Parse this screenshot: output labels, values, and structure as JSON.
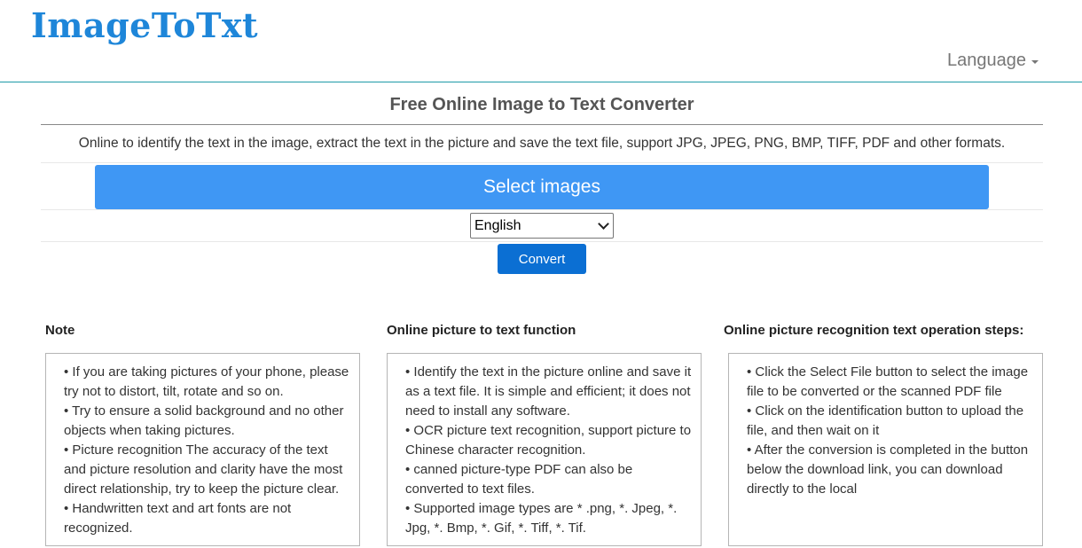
{
  "header": {
    "logo": "ImageToTxt",
    "language_menu": "Language"
  },
  "main": {
    "title": "Free Online Image to Text Converter",
    "description": "Online to identify the text in the image, extract the text in the picture and save the text file, support JPG, JPEG, PNG, BMP, TIFF, PDF and other formats.",
    "select_button": "Select images",
    "language_select": {
      "selected": "English"
    },
    "convert_button": "Convert"
  },
  "columns": [
    {
      "heading": "Note",
      "items": [
        "• If you are taking pictures of your phone, please try not to distort, tilt, rotate and so on.",
        "• Try to ensure a solid background and no other objects when taking pictures.",
        "• Picture recognition The accuracy of the text and picture resolution and clarity have the most direct relationship, try to keep the picture clear.",
        "• Handwritten text and art fonts are not recognized."
      ]
    },
    {
      "heading": "Online picture to text function",
      "items": [
        "• Identify the text in the picture online and save it as a text file. It is simple and efficient; it does not need to install any software.",
        "• OCR picture text recognition, support picture to Chinese character recognition.",
        "• canned picture-type PDF can also be converted to text files.",
        "• Supported image types are * .png, *. Jpeg, *. Jpg, *. Bmp, *. Gif, *. Tiff, *. Tif."
      ]
    },
    {
      "heading": "Online picture recognition text operation steps:",
      "items": [
        "•  Click the Select File button to select the image file to be converted or the scanned PDF file",
        "•  Click on the identification button to upload the file, and then wait on it",
        "•  After the conversion is completed in the button below the download link, you can download directly to the local"
      ]
    }
  ]
}
